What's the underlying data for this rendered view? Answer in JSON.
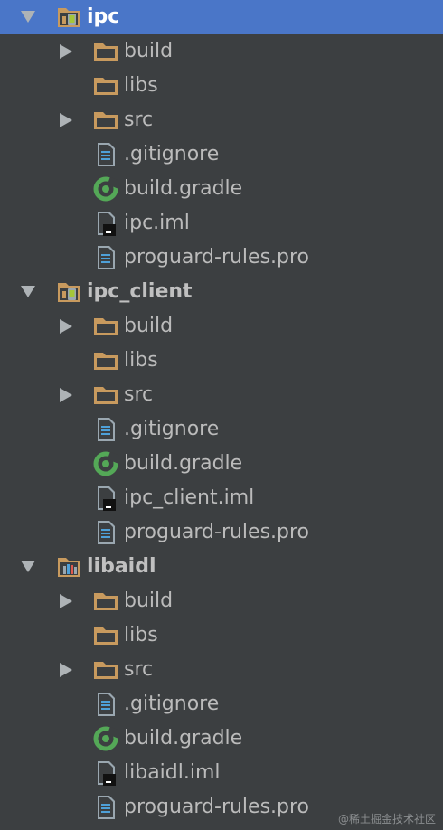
{
  "modules": [
    {
      "name": "ipc",
      "selected": true,
      "icon": "module-icon",
      "children": [
        {
          "label": "build",
          "icon": "folder-icon",
          "expandable": true
        },
        {
          "label": "libs",
          "icon": "folder-icon",
          "expandable": false
        },
        {
          "label": "src",
          "icon": "folder-icon",
          "expandable": true
        },
        {
          "label": ".gitignore",
          "icon": "text-file-icon",
          "expandable": false
        },
        {
          "label": "build.gradle",
          "icon": "gradle-icon",
          "expandable": false
        },
        {
          "label": "ipc.iml",
          "icon": "iml-file-icon",
          "expandable": false
        },
        {
          "label": "proguard-rules.pro",
          "icon": "text-file-icon",
          "expandable": false
        }
      ]
    },
    {
      "name": "ipc_client",
      "selected": false,
      "icon": "module-icon",
      "children": [
        {
          "label": "build",
          "icon": "folder-icon",
          "expandable": true
        },
        {
          "label": "libs",
          "icon": "folder-icon",
          "expandable": false
        },
        {
          "label": "src",
          "icon": "folder-icon",
          "expandable": true
        },
        {
          "label": ".gitignore",
          "icon": "text-file-icon",
          "expandable": false
        },
        {
          "label": "build.gradle",
          "icon": "gradle-icon",
          "expandable": false
        },
        {
          "label": "ipc_client.iml",
          "icon": "iml-file-icon",
          "expandable": false
        },
        {
          "label": "proguard-rules.pro",
          "icon": "text-file-icon",
          "expandable": false
        }
      ]
    },
    {
      "name": "libaidl",
      "selected": false,
      "icon": "library-module-icon",
      "children": [
        {
          "label": "build",
          "icon": "folder-icon",
          "expandable": true
        },
        {
          "label": "libs",
          "icon": "folder-icon",
          "expandable": false
        },
        {
          "label": "src",
          "icon": "folder-icon",
          "expandable": true
        },
        {
          "label": ".gitignore",
          "icon": "text-file-icon",
          "expandable": false
        },
        {
          "label": "build.gradle",
          "icon": "gradle-icon",
          "expandable": false
        },
        {
          "label": "libaidl.iml",
          "icon": "iml-file-icon",
          "expandable": false
        },
        {
          "label": "proguard-rules.pro",
          "icon": "text-file-icon",
          "expandable": false
        }
      ]
    }
  ],
  "watermark": "@稀土掘金技术社区",
  "colors": {
    "background": "#3c3f41",
    "selection": "#4a76c8",
    "text": "#bbbbbb",
    "folder": "#c89a5e",
    "gradle": "#54a857",
    "file_lines": "#4ea0d8"
  }
}
